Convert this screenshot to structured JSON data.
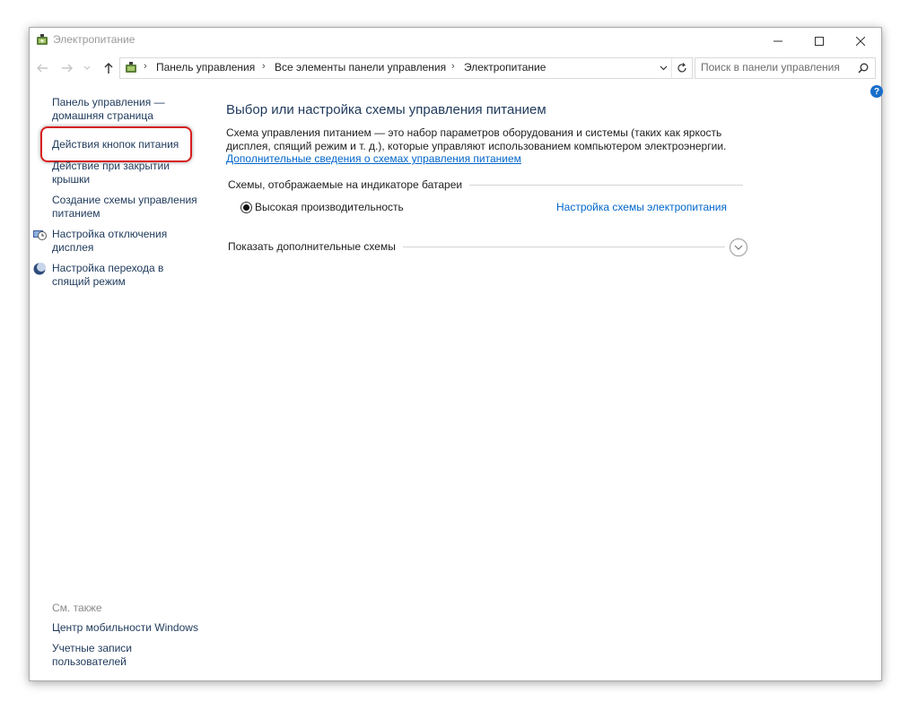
{
  "window": {
    "title": "Электропитание"
  },
  "address": {
    "crumbs": [
      "Панель управления",
      "Все элементы панели управления",
      "Электропитание"
    ]
  },
  "search": {
    "placeholder": "Поиск в панели управления"
  },
  "help": {
    "label": "?"
  },
  "sidebar": {
    "home_link": "Панель управления — домашняя страница",
    "tasks": [
      {
        "label": "Действия кнопок питания"
      },
      {
        "label": "Действие при закрытии крышки"
      },
      {
        "label": "Создание схемы управления питанием"
      },
      {
        "label": "Настройка отключения дисплея",
        "icon": "display-clock-icon"
      },
      {
        "label": "Настройка перехода в спящий режим",
        "icon": "sleep-moon-icon"
      }
    ],
    "see_also": {
      "heading": "См. также",
      "links": [
        {
          "label": "Центр мобильности Windows"
        },
        {
          "label": "Учетные записи пользователей"
        }
      ]
    }
  },
  "main": {
    "title": "Выбор или настройка схемы управления питанием",
    "description": "Схема управления питанием — это набор параметров оборудования и системы (таких как яркость дисплея, спящий режим и т. д.), которые управляют использованием компьютером электроэнергии.",
    "more_info_link": "Дополнительные сведения о схемах управления питанием",
    "section_heading": "Схемы, отображаемые на индикаторе батареи",
    "plans": [
      {
        "label": "Высокая производительность",
        "selected": true,
        "settings_link": "Настройка схемы электропитания"
      }
    ],
    "more_plans_label": "Показать дополнительные схемы"
  },
  "colors": {
    "link": "#1e395b",
    "hyperlink": "#0066cc",
    "highlight": "#d71e1e",
    "help": "#1a6fc9"
  }
}
